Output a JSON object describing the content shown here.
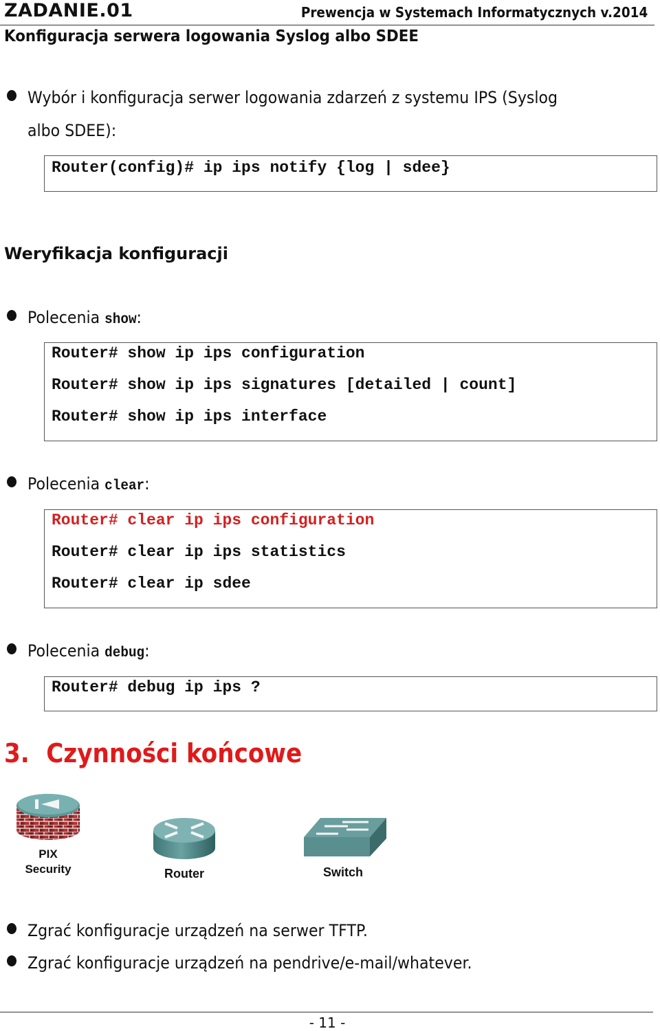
{
  "header": {
    "task_label": "ZADANIE.01",
    "course": "Prewencja w Systemach Informatycznych v.2014"
  },
  "doc_title": "Konfiguracja serwera logowania Syslog albo SDEE",
  "intro": {
    "bullet_line1": "Wybór i konfiguracja serwer logowania zdarzeń z systemu IPS (Syslog",
    "bullet_line2": "albo SDEE):",
    "commands": [
      "Router(config)# ip ips notify {log | sdee}"
    ]
  },
  "verification": {
    "heading": "Weryfikacja konfiguracji",
    "show": {
      "label": "Polecenia ",
      "keyword": "show",
      "suffix": ":",
      "commands": [
        "Router# show ip ips configuration",
        "Router# show ip ips signatures [detailed | count]",
        "Router# show ip ips interface"
      ]
    },
    "clear": {
      "label": "Polecenia ",
      "keyword": "clear",
      "suffix": ":",
      "commands": [
        "Router# clear ip ips configuration",
        "Router# clear ip ips statistics",
        "Router# clear ip sdee"
      ],
      "highlighted_index": 0,
      "highlight_color": "#d42020"
    },
    "debug": {
      "label": "Polecenia ",
      "keyword": "debug",
      "suffix": ":",
      "commands": [
        "Router# debug ip ips ?"
      ]
    }
  },
  "section3": {
    "number": "3.",
    "title": "Czynności końcowe",
    "color": "#e01a1a",
    "devices": [
      {
        "icon": "pix-firewall-icon",
        "label_line1": "PIX",
        "label_line2": "Security"
      },
      {
        "icon": "router-icon",
        "label_line1": "Router",
        "label_line2": ""
      },
      {
        "icon": "switch-icon",
        "label_line1": "Switch",
        "label_line2": ""
      }
    ],
    "bullets": [
      "Zgrać konfiguracje urządzeń na serwer TFTP.",
      "Zgrać konfiguracje urządzeń na pendrive/e-mail/whatever."
    ]
  },
  "footer": {
    "page_number": "- 11 -"
  }
}
